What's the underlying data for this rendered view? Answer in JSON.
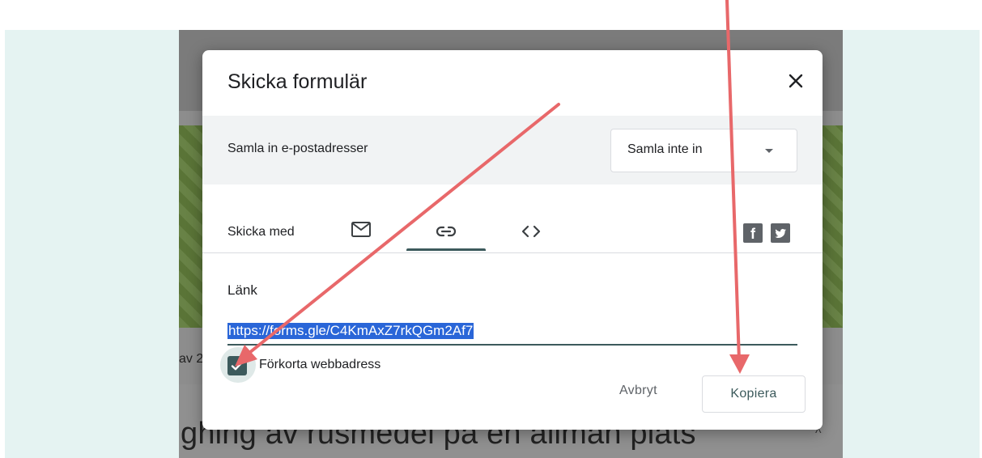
{
  "background": {
    "left_text": "av 2",
    "page_title": "ghing av rusmedel på en allmän plats",
    "caret": "^"
  },
  "dialog": {
    "title": "Skicka formulär",
    "close_icon": "close-icon",
    "email_collection": {
      "label": "Samla in e-postadresser",
      "selected": "Samla inte in"
    },
    "send_via": {
      "label": "Skicka med",
      "tabs": [
        {
          "icon": "mail-icon",
          "selected": false
        },
        {
          "icon": "link-icon",
          "selected": true
        },
        {
          "icon": "code-icon",
          "selected": false
        }
      ],
      "social": [
        {
          "icon": "facebook-icon",
          "glyph": "f"
        },
        {
          "icon": "twitter-icon",
          "glyph": "t"
        }
      ]
    },
    "link": {
      "heading": "Länk",
      "url": "https://forms.gle/C4KmAxZ7rkQGm2Af7",
      "shorten_label": "Förkorta webbadress",
      "shorten_checked": true
    },
    "actions": {
      "cancel": "Avbryt",
      "copy": "Kopiera"
    }
  },
  "colors": {
    "accent": "#3c5a5c",
    "annotation_arrow": "#e8686a",
    "selection": "#2a66d8"
  }
}
